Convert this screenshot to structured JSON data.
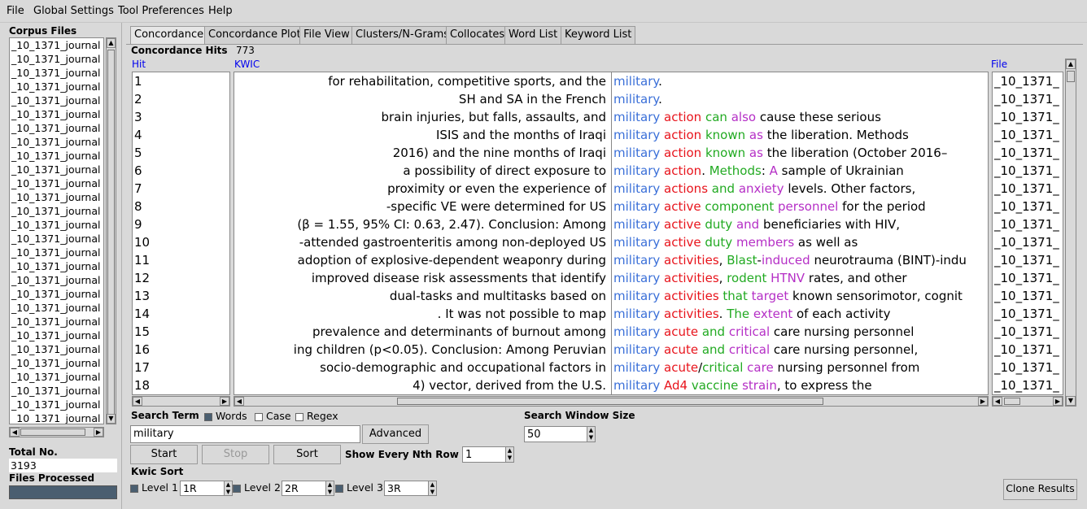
{
  "menu": [
    "File",
    "Global Settings",
    "Tool Preferences",
    "Help"
  ],
  "left": {
    "corpus_title": "Corpus Files",
    "corpus_files": [
      "_10_1371_journal",
      "_10_1371_journal",
      "_10_1371_journal",
      "_10_1371_journal",
      "_10_1371_journal",
      "_10_1371_journal",
      "_10_1371_journal",
      "_10_1371_journal",
      "_10_1371_journal",
      "_10_1371_journal",
      "_10_1371_journal",
      "_10_1371_journal",
      "_10_1371_journal",
      "_10_1371_journal",
      "_10_1371_journal",
      "_10_1371_journal",
      "_10_1371_journal",
      "_10_1371_journal",
      "_10_1371_journal",
      "_10_1371_journal",
      "_10_1371_journal",
      "_10_1371_journal",
      "_10_1371_journal",
      "_10_1371_journal",
      "_10_1371_journal",
      "_10_1371_journal",
      "_10_1371_journal",
      "_10_1371_journal"
    ],
    "total_label": "Total No.",
    "total_value": "3193",
    "files_processed_label": "Files Processed"
  },
  "tabs": [
    "Concordance",
    "Concordance Plot",
    "File View",
    "Clusters/N-Grams",
    "Collocates",
    "Word List",
    "Keyword List"
  ],
  "hits_label": "Concordance Hits",
  "hits_count": "773",
  "headers": {
    "hit": "Hit",
    "kwic": "KWIC",
    "file": "File"
  },
  "colors": {
    "key": "#3a6fd8",
    "red": "#e8141c",
    "green": "#22aa22",
    "magenta": "#b52fc6",
    "black": "#000000"
  },
  "rows": [
    {
      "n": "1",
      "left": "for rehabilitation, competitive sports, and the",
      "right": [
        [
          "military",
          "key"
        ],
        [
          ".",
          "black"
        ]
      ],
      "file": "_10_1371_"
    },
    {
      "n": "2",
      "left": "SH and SA in the French",
      "right": [
        [
          "military",
          "key"
        ],
        [
          ".",
          "black"
        ]
      ],
      "file": "_10_1371_"
    },
    {
      "n": "3",
      "left": "brain injuries, but falls, assaults, and",
      "right": [
        [
          "military",
          "key"
        ],
        [
          " ",
          "black"
        ],
        [
          "action",
          "red"
        ],
        [
          " ",
          "black"
        ],
        [
          "can",
          "green"
        ],
        [
          " ",
          "black"
        ],
        [
          "also",
          "magenta"
        ],
        [
          " cause these serious",
          "black"
        ]
      ],
      "file": "_10_1371_"
    },
    {
      "n": "4",
      "left": "ISIS and the months of Iraqi",
      "right": [
        [
          "military",
          "key"
        ],
        [
          " ",
          "black"
        ],
        [
          "action",
          "red"
        ],
        [
          " ",
          "black"
        ],
        [
          "known",
          "green"
        ],
        [
          " ",
          "black"
        ],
        [
          "as",
          "magenta"
        ],
        [
          " the liberation. Methods",
          "black"
        ]
      ],
      "file": "_10_1371_"
    },
    {
      "n": "5",
      "left": "2016) and the nine months of Iraqi",
      "right": [
        [
          "military",
          "key"
        ],
        [
          " ",
          "black"
        ],
        [
          "action",
          "red"
        ],
        [
          " ",
          "black"
        ],
        [
          "known",
          "green"
        ],
        [
          " ",
          "black"
        ],
        [
          "as",
          "magenta"
        ],
        [
          " the liberation (October 2016–",
          "black"
        ]
      ],
      "file": "_10_1371_"
    },
    {
      "n": "6",
      "left": "a possibility of direct exposure to",
      "right": [
        [
          "military",
          "key"
        ],
        [
          " ",
          "black"
        ],
        [
          "action",
          "red"
        ],
        [
          ". ",
          "black"
        ],
        [
          "Methods",
          "green"
        ],
        [
          ": ",
          "black"
        ],
        [
          "A",
          "magenta"
        ],
        [
          " sample of Ukrainian",
          "black"
        ]
      ],
      "file": "_10_1371_"
    },
    {
      "n": "7",
      "left": "proximity or even the experience of",
      "right": [
        [
          "military",
          "key"
        ],
        [
          " ",
          "black"
        ],
        [
          "actions",
          "red"
        ],
        [
          " ",
          "black"
        ],
        [
          "and",
          "green"
        ],
        [
          " ",
          "black"
        ],
        [
          "anxiety",
          "magenta"
        ],
        [
          " levels. Other factors,",
          "black"
        ]
      ],
      "file": "_10_1371_"
    },
    {
      "n": "8",
      "left": "-specific VE were determined for US",
      "right": [
        [
          "military",
          "key"
        ],
        [
          " ",
          "black"
        ],
        [
          "active",
          "red"
        ],
        [
          " ",
          "black"
        ],
        [
          "component",
          "green"
        ],
        [
          " ",
          "black"
        ],
        [
          "personnel",
          "magenta"
        ],
        [
          " for the period",
          "black"
        ]
      ],
      "file": "_10_1371_"
    },
    {
      "n": "9",
      "left": "(β = 1.55, 95% CI: 0.63, 2.47). Conclusion: Among",
      "right": [
        [
          "military",
          "key"
        ],
        [
          " ",
          "black"
        ],
        [
          "active",
          "red"
        ],
        [
          " ",
          "black"
        ],
        [
          "duty",
          "green"
        ],
        [
          " ",
          "black"
        ],
        [
          "and",
          "magenta"
        ],
        [
          " beneficiaries with HIV,",
          "black"
        ]
      ],
      "file": "_10_1371_"
    },
    {
      "n": "10",
      "left": "-attended gastroenteritis among non-deployed US",
      "right": [
        [
          "military",
          "key"
        ],
        [
          " ",
          "black"
        ],
        [
          "active",
          "red"
        ],
        [
          " ",
          "black"
        ],
        [
          "duty",
          "green"
        ],
        [
          " ",
          "black"
        ],
        [
          "members",
          "magenta"
        ],
        [
          " as well as",
          "black"
        ]
      ],
      "file": "_10_1371_"
    },
    {
      "n": "11",
      "left": "adoption of explosive-dependent weaponry during",
      "right": [
        [
          "military",
          "key"
        ],
        [
          " ",
          "black"
        ],
        [
          "activities",
          "red"
        ],
        [
          ", ",
          "black"
        ],
        [
          "Blast",
          "green"
        ],
        [
          "-",
          "black"
        ],
        [
          "induced",
          "magenta"
        ],
        [
          " neurotrauma (BINT)-indu",
          "black"
        ]
      ],
      "file": "_10_1371_"
    },
    {
      "n": "12",
      "left": "improved disease risk assessments that identify",
      "right": [
        [
          "military",
          "key"
        ],
        [
          " ",
          "black"
        ],
        [
          "activities",
          "red"
        ],
        [
          ", ",
          "black"
        ],
        [
          "rodent",
          "green"
        ],
        [
          " ",
          "black"
        ],
        [
          "HTNV",
          "magenta"
        ],
        [
          " rates, and other",
          "black"
        ]
      ],
      "file": "_10_1371_"
    },
    {
      "n": "13",
      "left": "dual-tasks and multitasks based on",
      "right": [
        [
          "military",
          "key"
        ],
        [
          " ",
          "black"
        ],
        [
          "activities",
          "red"
        ],
        [
          " ",
          "black"
        ],
        [
          "that",
          "green"
        ],
        [
          " ",
          "black"
        ],
        [
          "target",
          "magenta"
        ],
        [
          " known sensorimotor, cognit",
          "black"
        ]
      ],
      "file": "_10_1371_"
    },
    {
      "n": "14",
      "left": ". It was not possible to map",
      "right": [
        [
          "military",
          "key"
        ],
        [
          " ",
          "black"
        ],
        [
          "activities",
          "red"
        ],
        [
          ". ",
          "black"
        ],
        [
          "The",
          "green"
        ],
        [
          " ",
          "black"
        ],
        [
          "extent",
          "magenta"
        ],
        [
          " of each activity",
          "black"
        ]
      ],
      "file": "_10_1371_"
    },
    {
      "n": "15",
      "left": "prevalence and determinants of burnout among",
      "right": [
        [
          "military",
          "key"
        ],
        [
          " ",
          "black"
        ],
        [
          "acute",
          "red"
        ],
        [
          " ",
          "black"
        ],
        [
          "and",
          "green"
        ],
        [
          " ",
          "black"
        ],
        [
          "critical",
          "magenta"
        ],
        [
          " care nursing personnel",
          "black"
        ]
      ],
      "file": "_10_1371_"
    },
    {
      "n": "16",
      "left": "ing children (p<0.05). Conclusion: Among Peruvian",
      "right": [
        [
          "military",
          "key"
        ],
        [
          " ",
          "black"
        ],
        [
          "acute",
          "red"
        ],
        [
          " ",
          "black"
        ],
        [
          "and",
          "green"
        ],
        [
          " ",
          "black"
        ],
        [
          "critical",
          "magenta"
        ],
        [
          " care nursing personnel,",
          "black"
        ]
      ],
      "file": "_10_1371_"
    },
    {
      "n": "17",
      "left": "socio-demographic and occupational factors in",
      "right": [
        [
          "military",
          "key"
        ],
        [
          " ",
          "black"
        ],
        [
          "acute",
          "red"
        ],
        [
          "/",
          "black"
        ],
        [
          "critical",
          "green"
        ],
        [
          " ",
          "black"
        ],
        [
          "care",
          "magenta"
        ],
        [
          " nursing personnel from",
          "black"
        ]
      ],
      "file": "_10_1371_"
    },
    {
      "n": "18",
      "left": "4) vector, derived from the U.S.",
      "right": [
        [
          "military",
          "key"
        ],
        [
          " ",
          "black"
        ],
        [
          "Ad4",
          "red"
        ],
        [
          " ",
          "black"
        ],
        [
          "vaccine",
          "green"
        ],
        [
          " ",
          "black"
        ],
        [
          "strain",
          "magenta"
        ],
        [
          ", to express the",
          "black"
        ]
      ],
      "file": "_10_1371_"
    }
  ],
  "search": {
    "term_label": "Search Term",
    "words_label": "Words",
    "words_checked": true,
    "case_label": "Case",
    "case_checked": false,
    "regex_label": "Regex",
    "regex_checked": false,
    "term_value": "military",
    "advanced_label": "Advanced",
    "window_label": "Search Window Size",
    "window_value": "50"
  },
  "actions": {
    "start": "Start",
    "stop": "Stop",
    "sort": "Sort",
    "nth_label": "Show Every Nth Row",
    "nth_value": "1"
  },
  "kwic_sort": {
    "label": "Kwic Sort",
    "levels": [
      {
        "label": "Level 1",
        "value": "1R",
        "checked": true
      },
      {
        "label": "Level 2",
        "value": "2R",
        "checked": true
      },
      {
        "label": "Level 3",
        "value": "3R",
        "checked": true
      }
    ]
  },
  "clone_label": "Clone Results"
}
